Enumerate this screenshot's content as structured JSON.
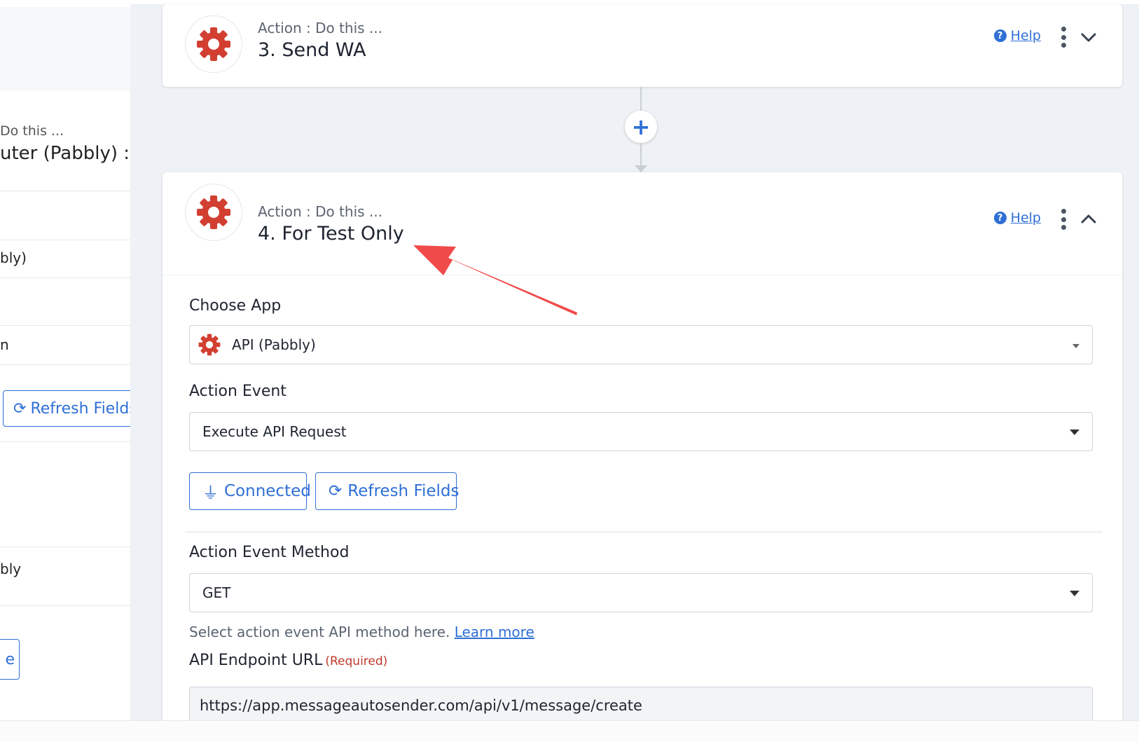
{
  "left_panel": {
    "subtitle": "Do this ...",
    "title": "uter (Pabbly) : C",
    "row1": "bly)",
    "row2": "n",
    "refresh_label": "Refresh Fields",
    "row3": "bly",
    "btn2_label": "e"
  },
  "card1": {
    "subtitle": "Action : Do this ...",
    "title": "3. Send WA",
    "help_label": "Help"
  },
  "connector": {
    "add_symbol": "+"
  },
  "card2": {
    "subtitle": "Action : Do this ...",
    "title": "4. For Test Only",
    "help_label": "Help",
    "choose_app_label": "Choose App",
    "choose_app_value": "API (Pabbly)",
    "action_event_label": "Action Event",
    "action_event_value": "Execute API Request",
    "connected_label": "Connected",
    "refresh_label": "Refresh Fields",
    "method_label": "Action Event Method",
    "method_value": "GET",
    "method_hint": "Select action event API method here.",
    "learn_more": "Learn more",
    "endpoint_label": "API Endpoint URL",
    "required_label": "(Required)",
    "endpoint_value": "https://app.messageautosender.com/api/v1/message/create"
  },
  "colors": {
    "accent": "#2f6fd6",
    "gear": "#d23f31",
    "annotation": "#f04a4a"
  }
}
